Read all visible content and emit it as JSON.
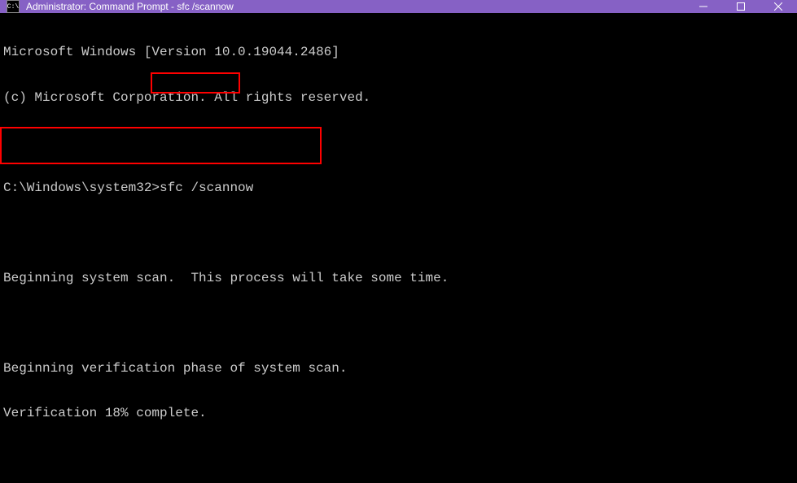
{
  "titlebar": {
    "icon_text": "C:\\",
    "title": "Administrator: Command Prompt - sfc  /scannow"
  },
  "terminal": {
    "line1": "Microsoft Windows [Version 10.0.19044.2486]",
    "line2": "(c) Microsoft Corporation. All rights reserved.",
    "blank1": "",
    "prompt_prefix": "C:\\Windows\\system32>",
    "prompt_command": "sfc /scannow",
    "blank2": "",
    "line4": "Beginning system scan.  This process will take some time.",
    "blank3": "",
    "line5": "Beginning verification phase of system scan.",
    "line6": "Verification 18% complete."
  }
}
